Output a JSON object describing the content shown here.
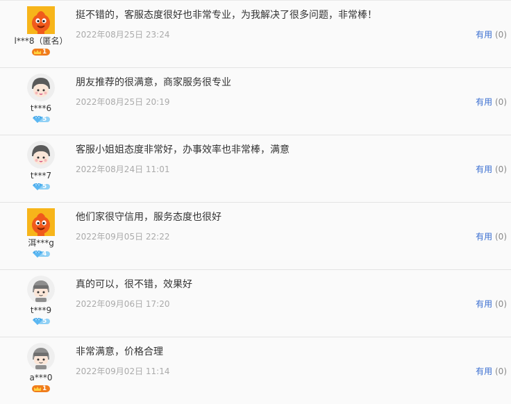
{
  "reviews": [
    {
      "avatar": "orange-mascot-avatar",
      "user": "l***8（匿名）",
      "badge": {
        "type": "crown",
        "level": "1"
      },
      "content": "挺不错的，客服态度很好也非常专业，为我解决了很多问题，非常棒！",
      "date": "2022年08月25日 23:24",
      "useful_label": "有用",
      "useful_count": "(0)"
    },
    {
      "avatar": "girl-avatar",
      "user": "t***6",
      "badge": {
        "type": "diamond",
        "level": "5"
      },
      "content": "朋友推荐的很满意，商家服务很专业",
      "date": "2022年08月25日 20:19",
      "useful_label": "有用",
      "useful_count": "(0)"
    },
    {
      "avatar": "girl-avatar",
      "user": "t***7",
      "badge": {
        "type": "diamond",
        "level": "5"
      },
      "content": "客服小姐姐态度非常好，办事效率也非常棒，满意",
      "date": "2022年08月24日 11:01",
      "useful_label": "有用",
      "useful_count": "(0)"
    },
    {
      "avatar": "orange-mascot-avatar",
      "user": "洱***g",
      "badge": {
        "type": "diamond",
        "level": "4"
      },
      "content": "他们家很守信用，服务态度也很好",
      "date": "2022年09月05日 22:22",
      "useful_label": "有用",
      "useful_count": "(0)"
    },
    {
      "avatar": "helmet-avatar",
      "user": "t***9",
      "badge": {
        "type": "diamond",
        "level": "5"
      },
      "content": "真的可以，很不错，效果好",
      "date": "2022年09月06日 17:20",
      "useful_label": "有用",
      "useful_count": "(0)"
    },
    {
      "avatar": "helmet-avatar",
      "user": "a***0",
      "badge": {
        "type": "crown",
        "level": "1"
      },
      "content": "非常满意，价格合理",
      "date": "2022年09月02日 11:14",
      "useful_label": "有用",
      "useful_count": "(0)"
    }
  ],
  "colors": {
    "link": "#3b6fd1",
    "crown": "#f5a623",
    "diamond": "#5bb7f2",
    "muted": "#aaaaaa"
  }
}
